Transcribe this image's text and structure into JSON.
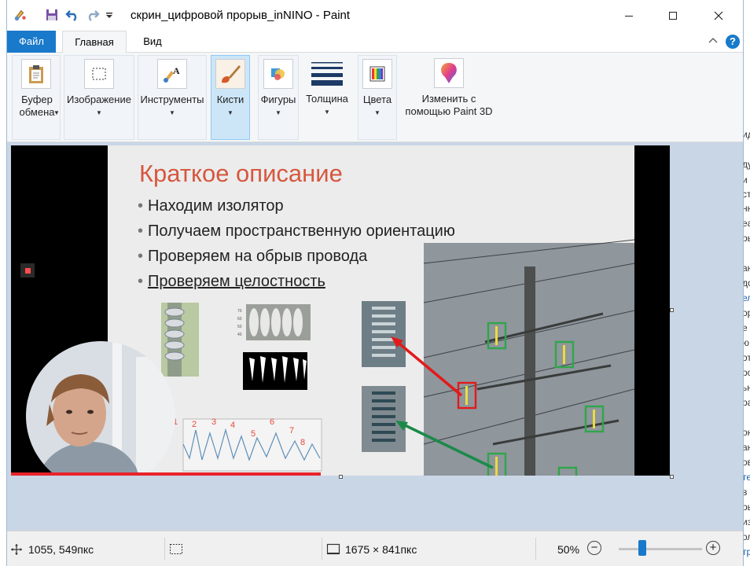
{
  "window": {
    "title": "скрин_цифровой прорыв_inNINO - Paint"
  },
  "tabs": {
    "file": "Файл",
    "home": "Главная",
    "view": "Вид",
    "help": "?"
  },
  "ribbon": {
    "clipboard": "Буфер обмена",
    "image": "Изображение",
    "tools": "Инструменты",
    "brushes": "Кисти",
    "shapes": "Фигуры",
    "size": "Толщина",
    "colors": "Цвета",
    "paint3d": "Изменить с помощью Paint 3D"
  },
  "slide": {
    "title": "Краткое описание",
    "bullets": [
      "Находим изолятор",
      "Получаем пространственную ориентацию",
      "Проверяем на обрыв провода",
      "Проверяем целостность"
    ],
    "chart_numbers": [
      "1",
      "2",
      "3",
      "4",
      "5",
      "6",
      "7",
      "8"
    ],
    "y_ticks": [
      "70",
      "60",
      "50",
      "40"
    ]
  },
  "video_progress": 0.47,
  "statusbar": {
    "cursor_pos": "1055, 549пкс",
    "image_size": "1675 × 841пкс",
    "zoom": "50%",
    "zoom_level": 0.28
  },
  "background_window": {
    "fragments": [
      "ид",
      "ду",
      "и",
      "ст",
      "нн",
      "еа",
      "ры",
      "ан",
      "до",
      "ел",
      "ор",
      "е",
      "ю",
      "от",
      "ро",
      "ьн",
      "ра",
      "он",
      "ан",
      "ов",
      "те",
      "в",
      "ры",
      "из",
      "ол",
      "тр",
      "ро"
    ]
  },
  "colors": {
    "accent": "#1979ca",
    "canvas_bg": "#c9d6e6",
    "slide_title": "#d6573f",
    "progress": "#e8232a"
  }
}
